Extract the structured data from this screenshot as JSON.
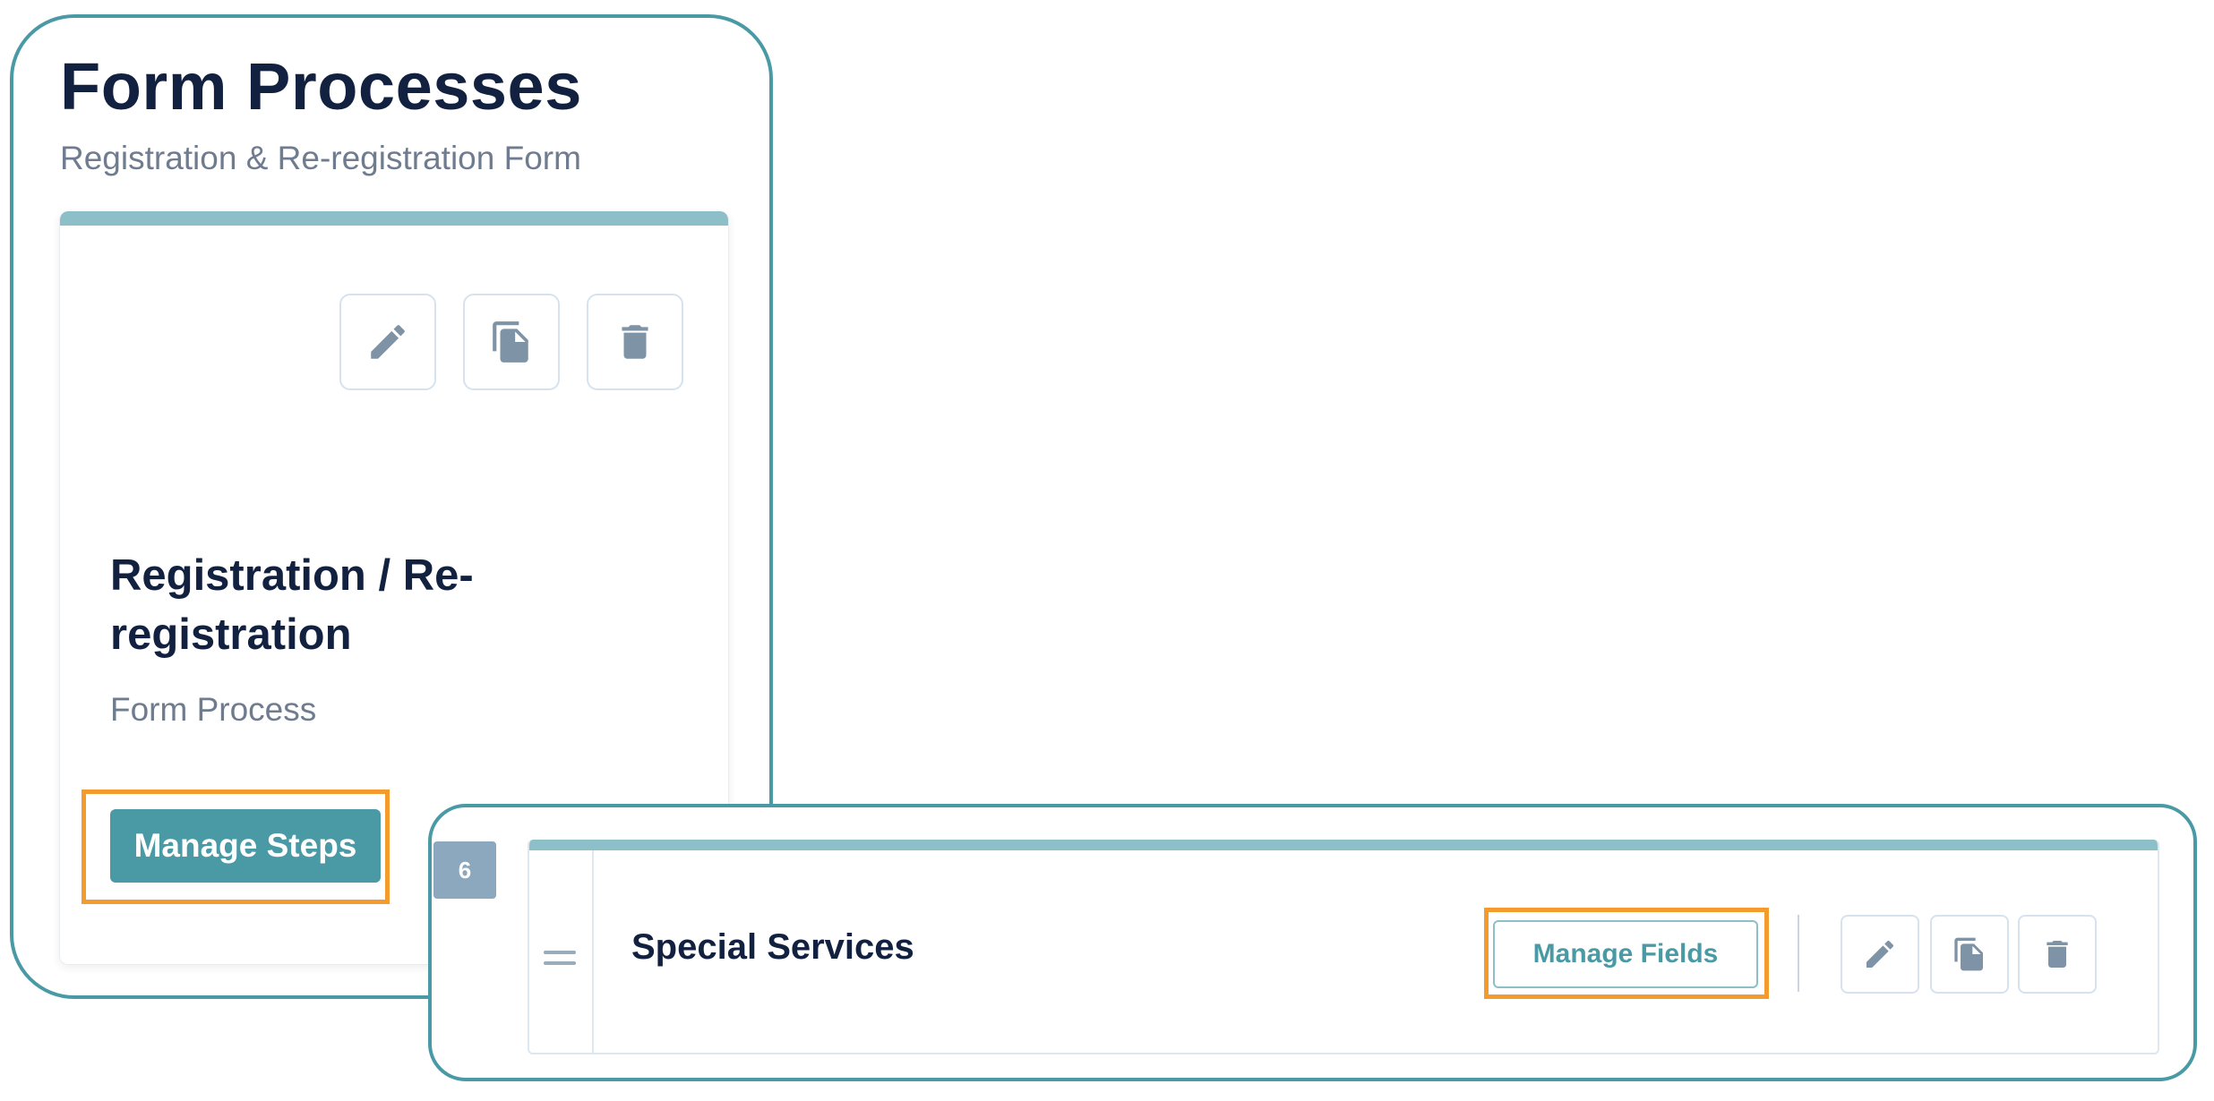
{
  "header": {
    "title": "Form Processes",
    "subtitle": "Registration & Re-registration Form"
  },
  "process_card": {
    "title": "Registration / Re-registration",
    "type_label": "Form Process",
    "manage_steps_label": "Manage Steps",
    "actions": [
      "edit-icon",
      "copy-icon",
      "delete-icon"
    ]
  },
  "step": {
    "number": "6",
    "title": "Special Services",
    "manage_fields_label": "Manage Fields",
    "actions": [
      "edit-icon",
      "copy-icon",
      "delete-icon"
    ]
  },
  "colors": {
    "accent": "#4a9aa6",
    "accent_light": "#8cbfc7",
    "highlight": "#f39b2d",
    "title_text": "#12213f",
    "muted_text": "#6f7c90",
    "icon": "#7f93a6"
  }
}
